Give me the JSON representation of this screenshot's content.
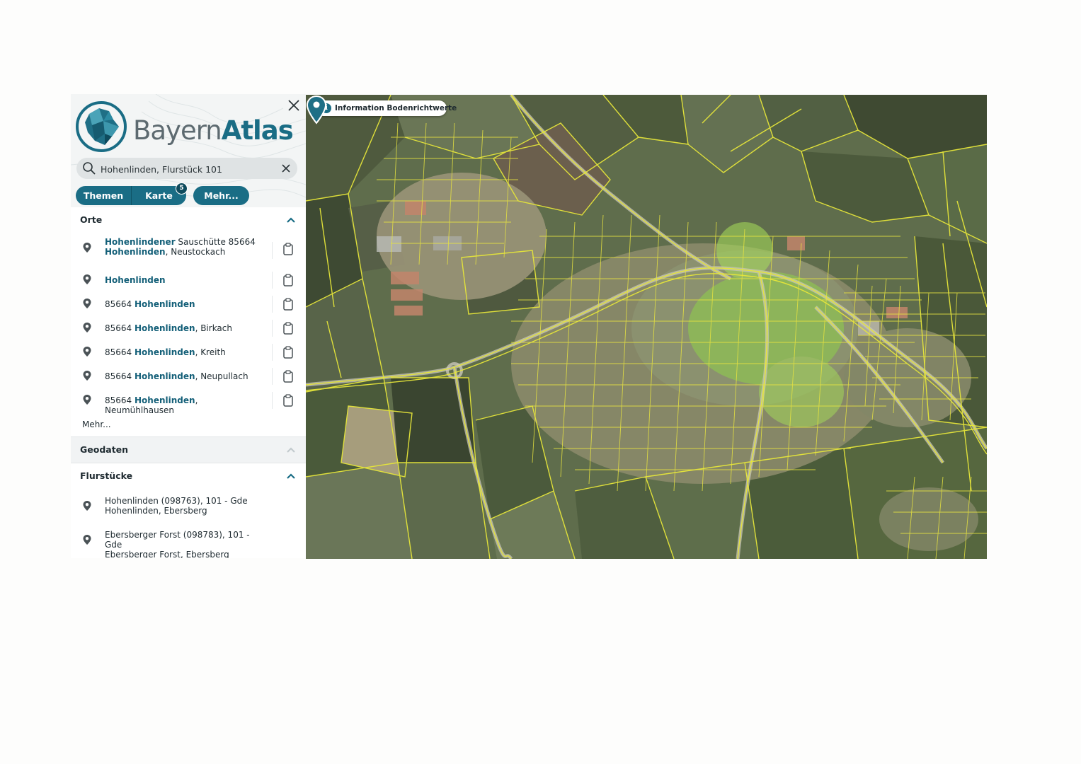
{
  "app": {
    "logo_text_light": "Bayern",
    "logo_text_bold": "Atlas",
    "brand_color": "#1a6d85",
    "accent_dark": "#135f78"
  },
  "search": {
    "value": "Hohenlinden, Flurstück 101",
    "icon": "search-icon",
    "clear_icon": "close-icon"
  },
  "tabs": {
    "themen": "Themen",
    "karte": "Karte",
    "karte_badge": "5",
    "mehr": "Mehr..."
  },
  "sections": {
    "orte": {
      "title": "Orte",
      "items": [
        {
          "l1_bold": "Hohenlindener",
          "l1_rest": " Sauschütte 85664",
          "l2_bold": "Hohenlinden",
          "l2_rest": ", Neustockach"
        },
        {
          "pre": "",
          "bold": "Hohenlinden",
          "rest": ""
        },
        {
          "pre": "85664 ",
          "bold": "Hohenlinden",
          "rest": ""
        },
        {
          "pre": "85664 ",
          "bold": "Hohenlinden",
          "rest": ", Birkach"
        },
        {
          "pre": "85664 ",
          "bold": "Hohenlinden",
          "rest": ", Kreith"
        },
        {
          "pre": "85664 ",
          "bold": "Hohenlinden",
          "rest": ", Neupullach"
        },
        {
          "pre": "85664 ",
          "bold": "Hohenlinden",
          "rest": ", Neumühlhausen"
        }
      ],
      "more": "Mehr..."
    },
    "geodaten": {
      "title": "Geodaten"
    },
    "flurstuecke": {
      "title": "Flurstücke",
      "items": [
        {
          "line1": "Hohenlinden (098763), 101 - Gde",
          "line2": "Hohenlinden, Ebersberg"
        },
        {
          "line1": "Ebersberger Forst (098783), 101 - Gde",
          "line2": "Ebersberger Forst, Ebersberg"
        }
      ]
    }
  },
  "map": {
    "info_button": "Information Bodenrichtwerte",
    "marker_icon": "map-pin-icon",
    "parcel_line_color": "#e6e63a"
  }
}
